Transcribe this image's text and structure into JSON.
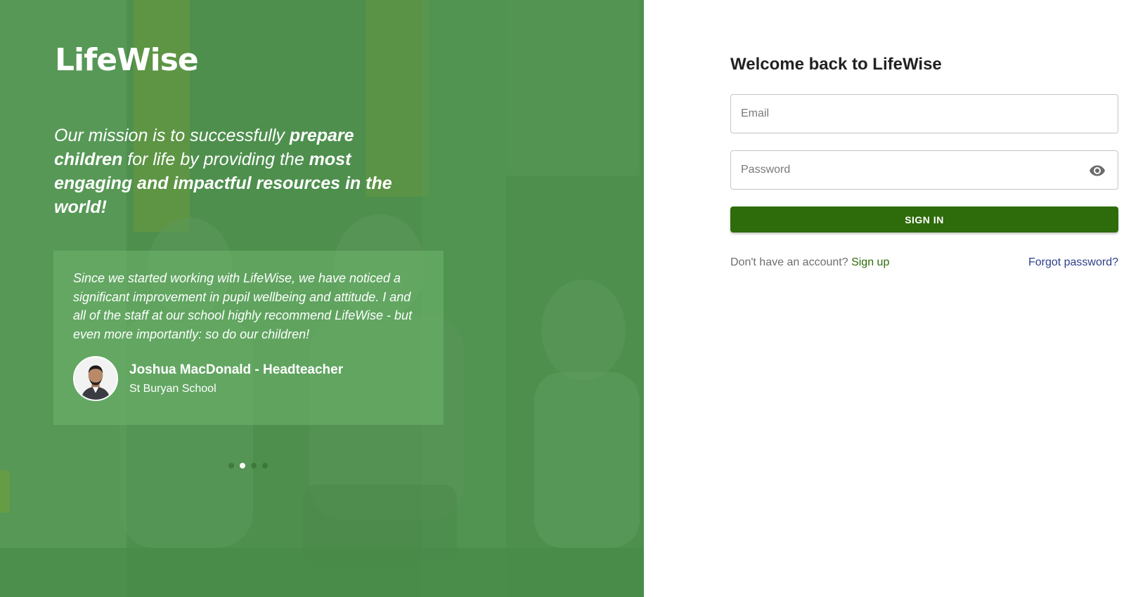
{
  "colors": {
    "hero_green": "#4e8f4e",
    "brand_dark_green": "#2e6b0a",
    "link_blue": "#2d3e8a",
    "title_text": "#222222"
  },
  "hero": {
    "logo_text": "LifeWise",
    "mission": {
      "part1": "Our mission is to successfully ",
      "bold1": "prepare children",
      "part2": " for life by providing the ",
      "bold2": "most engaging and impactful resources in the world!"
    },
    "testimonial": {
      "quote": "Since we started working with LifeWise, we have noticed a significant improvement in pupil wellbeing and attitude. I and all of the staff at our school highly recommend LifeWise - but even more importantly: so do our children!",
      "author_name": "Joshua MacDonald - Headteacher",
      "author_school": "St Buryan School"
    },
    "carousel": {
      "slide_count": 4,
      "active_index": 1
    }
  },
  "login": {
    "title": "Welcome back to LifeWise",
    "email_placeholder": "Email",
    "password_placeholder": "Password",
    "password_toggle_icon": "eye-icon",
    "signin_label": "SIGN IN",
    "no_account_text": "Don't have an account?",
    "signup_label": "Sign up",
    "forgot_label": "Forgot password?"
  }
}
